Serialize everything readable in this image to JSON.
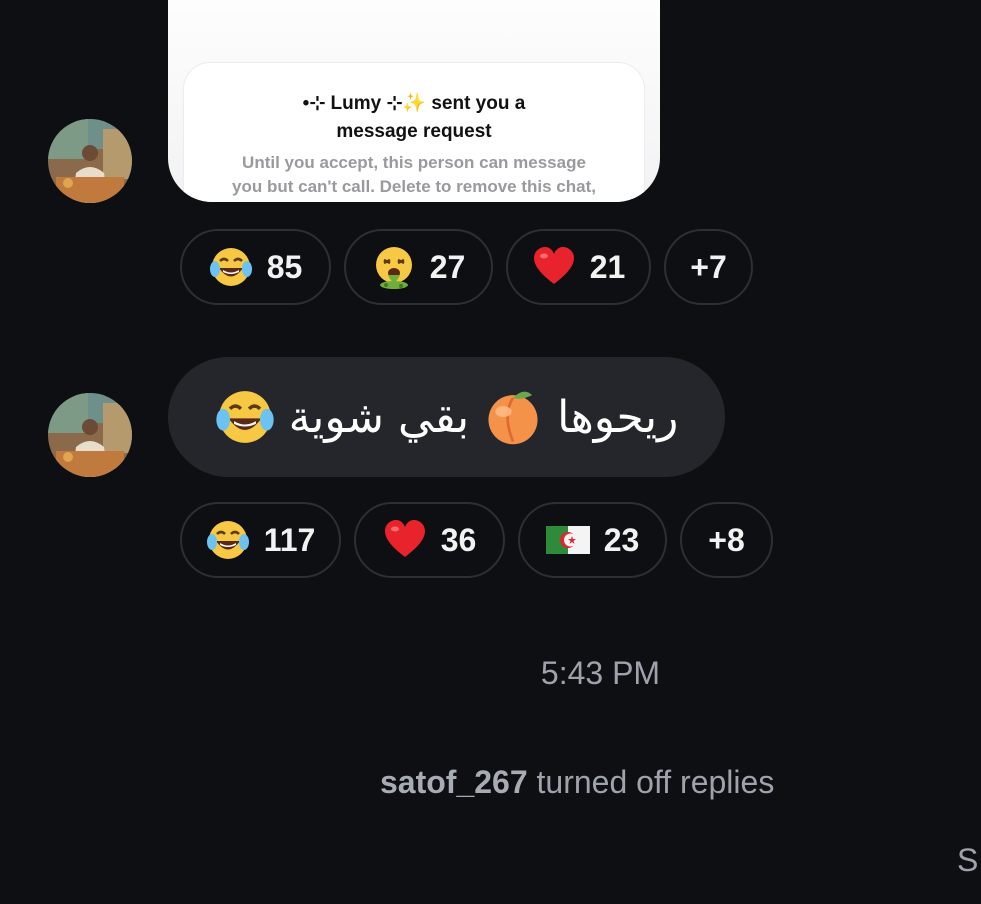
{
  "shared_post": {
    "title_line1": "•⊹ Lumy ⊹✨ sent you a",
    "title_line2": "message request",
    "subtitle_line1": "Until you accept, this person can message",
    "subtitle_line2": "you but can't call. Delete to remove this chat,"
  },
  "reactions_1": [
    {
      "icon": "tears-of-joy-icon",
      "count": "85"
    },
    {
      "icon": "vomiting-face-icon",
      "count": "27"
    },
    {
      "icon": "red-heart-icon",
      "count": "21"
    },
    {
      "more": "+7"
    }
  ],
  "message": {
    "text": "ريحوها",
    "text2": "بقي شوية",
    "emoji1": "peach-icon",
    "emoji2": "tears-of-joy-icon"
  },
  "reactions_2": [
    {
      "icon": "tears-of-joy-icon",
      "count": "117"
    },
    {
      "icon": "red-heart-icon",
      "count": "36"
    },
    {
      "icon": "algeria-flag-icon",
      "count": "23"
    },
    {
      "more": "+8"
    }
  ],
  "timestamp": "5:43 PM",
  "notice": {
    "user": "satof_267",
    "text": "turned off replies"
  },
  "edge_text": "S",
  "colors": {
    "background": "#0d0f13",
    "bubble": "#24262b",
    "pill_border": "#2c2f35",
    "muted_text": "#9ea2ab"
  }
}
